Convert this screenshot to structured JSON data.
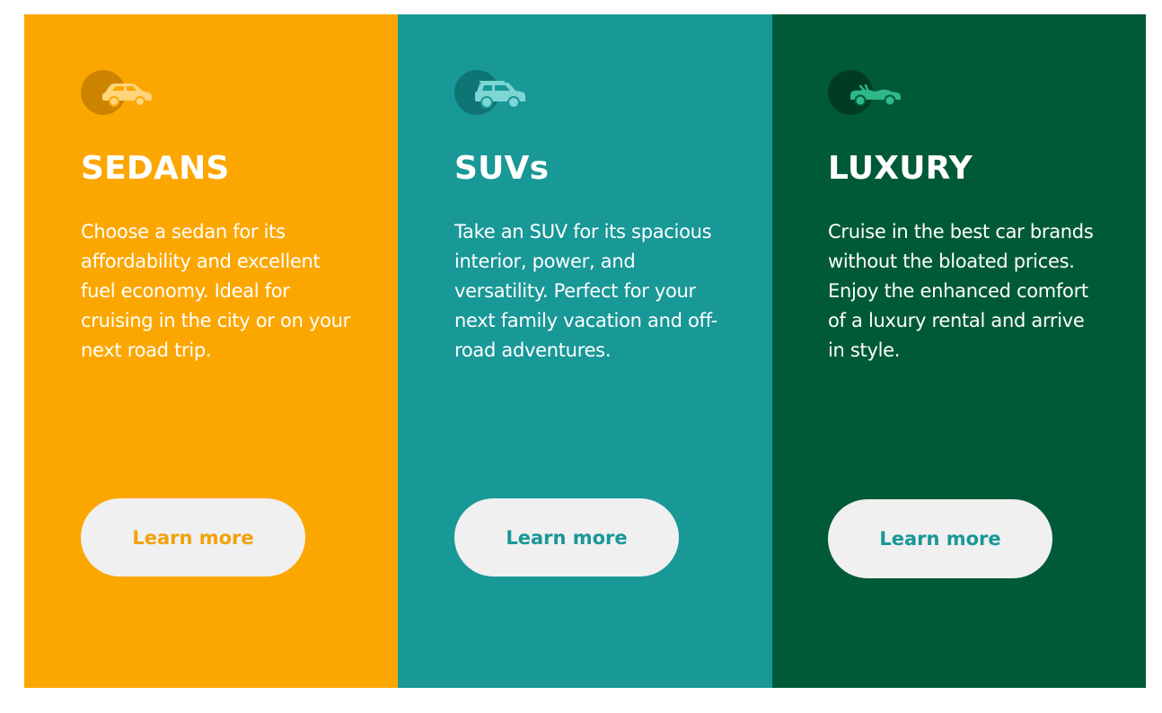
{
  "cards": [
    {
      "title": "SEDANS",
      "description": "Choose a sedan for its affordability and excellent fuel economy. Ideal for cruising in the city or on your next road trip.",
      "button_label": "Learn more",
      "icon": "sedan-car-icon",
      "background_color": "#fca701",
      "accent_color": "#f2a20a"
    },
    {
      "title": "SUVs",
      "description": "Take an SUV for its spacious interior, power, and versatility. Perfect for your next family vacation and off-road adventures.",
      "button_label": "Learn more",
      "icon": "suv-car-icon",
      "background_color": "#189897",
      "accent_color": "#189897"
    },
    {
      "title": "LUXURY",
      "description": "Cruise in the best car brands without the bloated prices. Enjoy the enhanced comfort of a luxury rental and arrive in style.",
      "button_label": "Learn more",
      "icon": "luxury-convertible-icon",
      "background_color": "#005a37",
      "accent_color": "#189897"
    }
  ]
}
